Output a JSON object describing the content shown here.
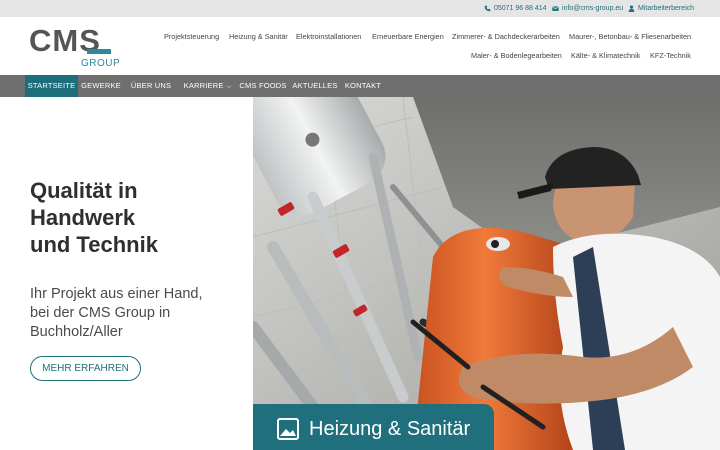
{
  "topbar": {
    "phone": "05071 96 88 414",
    "email": "info@cms-group.eu",
    "staff": "Mitarbeiterbereich"
  },
  "logo": {
    "brand": "CMS",
    "group": "GROUP"
  },
  "services": {
    "row1": [
      "Projektsteuerung",
      "Heizung & Sanitär",
      "Elektroinstallationen",
      "Erneuerbare Energien",
      "Zimmerer- & Dachdeckerarbeiten",
      "Maurer-, Betonbau- & Fliesenarbeiten"
    ],
    "row2": [
      "Maler- & Bodenlegearbeiten",
      "Kälte- & Klimatechnik",
      "KFZ-Technik"
    ]
  },
  "nav": {
    "items": [
      "STARTSEITE",
      "GEWERKE",
      "ÜBER UNS",
      "KARRIERE",
      "CMS FOODS",
      "AKTUELLES",
      "KONTAKT"
    ],
    "active": "STARTSEITE"
  },
  "hero": {
    "title_line1": "Qualität in",
    "title_line2": "Handwerk",
    "title_line3": "und Technik",
    "subtitle_line1": "Ihr Projekt aus einer Hand,",
    "subtitle_line2": "bei der CMS Group in",
    "subtitle_line3": "Buchholz/Aller",
    "button": "MEHR ERFAHREN",
    "image_tag": "Heizung & Sanitär"
  },
  "colors": {
    "accent": "#1f6f7c",
    "nav_bg": "#6f6f6f",
    "topbar_bg": "#e5e5e5"
  }
}
